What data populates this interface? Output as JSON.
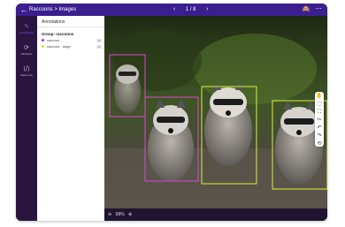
{
  "header": {
    "breadcrumb": "Raccoons > Images",
    "page_counter": "1 / 8",
    "prev": "‹",
    "next": "›",
    "back": "←",
    "right_icons": [
      "🙈",
      "⋯"
    ]
  },
  "rail": {
    "items": [
      {
        "label": "Annotations",
        "icon": "✎"
      },
      {
        "label": "Attributes",
        "icon": "⟳"
      },
      {
        "label": "Data tools",
        "icon": "⟨/⟩"
      }
    ]
  },
  "panel": {
    "title": "Annotations",
    "group_title": "Group: raccoons",
    "rows": [
      {
        "label": "raccoon",
        "count": "0",
        "color": "#c13ccf"
      },
      {
        "label": "raccoon - large",
        "count": "0",
        "color": "#d6e23a"
      }
    ]
  },
  "bottom": {
    "zoom_out": "⊖",
    "zoom_level": "58%",
    "zoom_in": "⊕"
  },
  "tools": [
    "✋",
    "⬚",
    "⛶",
    "✂",
    "↶",
    "↷",
    "⟲"
  ],
  "colors": {
    "accent": "#3b1f8f",
    "pink_box": "#d84ad0",
    "yellow_box": "#d8f03a"
  }
}
